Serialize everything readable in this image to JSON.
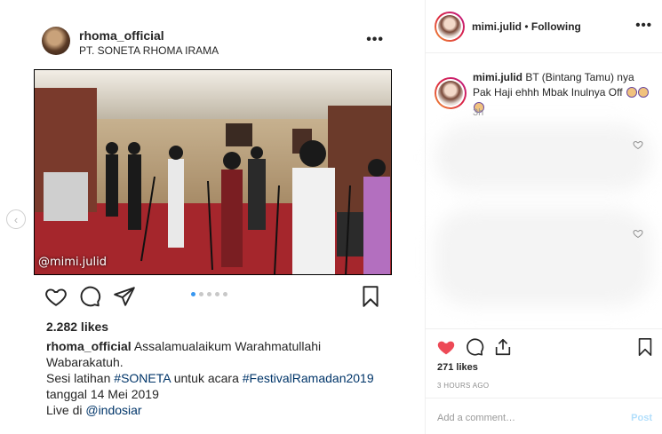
{
  "post": {
    "username": "rhoma_official",
    "location": "PT. SONETA RHOMA IRAMA",
    "more_icon": "more-horizontal-icon",
    "photo_watermark": "@mimi.julid",
    "carousel_dots": 5,
    "carousel_active": 1,
    "likes": "2.282 likes",
    "caption": {
      "username": "rhoma_official",
      "line1": "Assalamualaikum Warahmatullahi",
      "line2": "Wabarakatuh.",
      "line3_pre": "Sesi latihan ",
      "hashtag1": "#SONETA",
      "line3_mid": " untuk acara ",
      "hashtag2": "#FestivalRamadan2019",
      "line4": "tanggal 14 Mei 2019",
      "line5_pre": "Live di ",
      "mention": "@indosiar"
    }
  },
  "panel": {
    "username": "mimi.julid",
    "separator": " • ",
    "follow_status": "Following",
    "comment": {
      "username": "mimi.julid",
      "text": " BT (Bintang Tamu) nya Pak Haji ehhh Mbak Inulnya Off ",
      "time": "3h"
    },
    "likes": "271 likes",
    "time_ago": "3 HOURS AGO",
    "add_comment_placeholder": "Add a comment…",
    "post_button": "Post"
  },
  "colors": {
    "liked_heart": "#ed4956",
    "hashtag": "#003569",
    "active_dot": "#3897f0"
  }
}
